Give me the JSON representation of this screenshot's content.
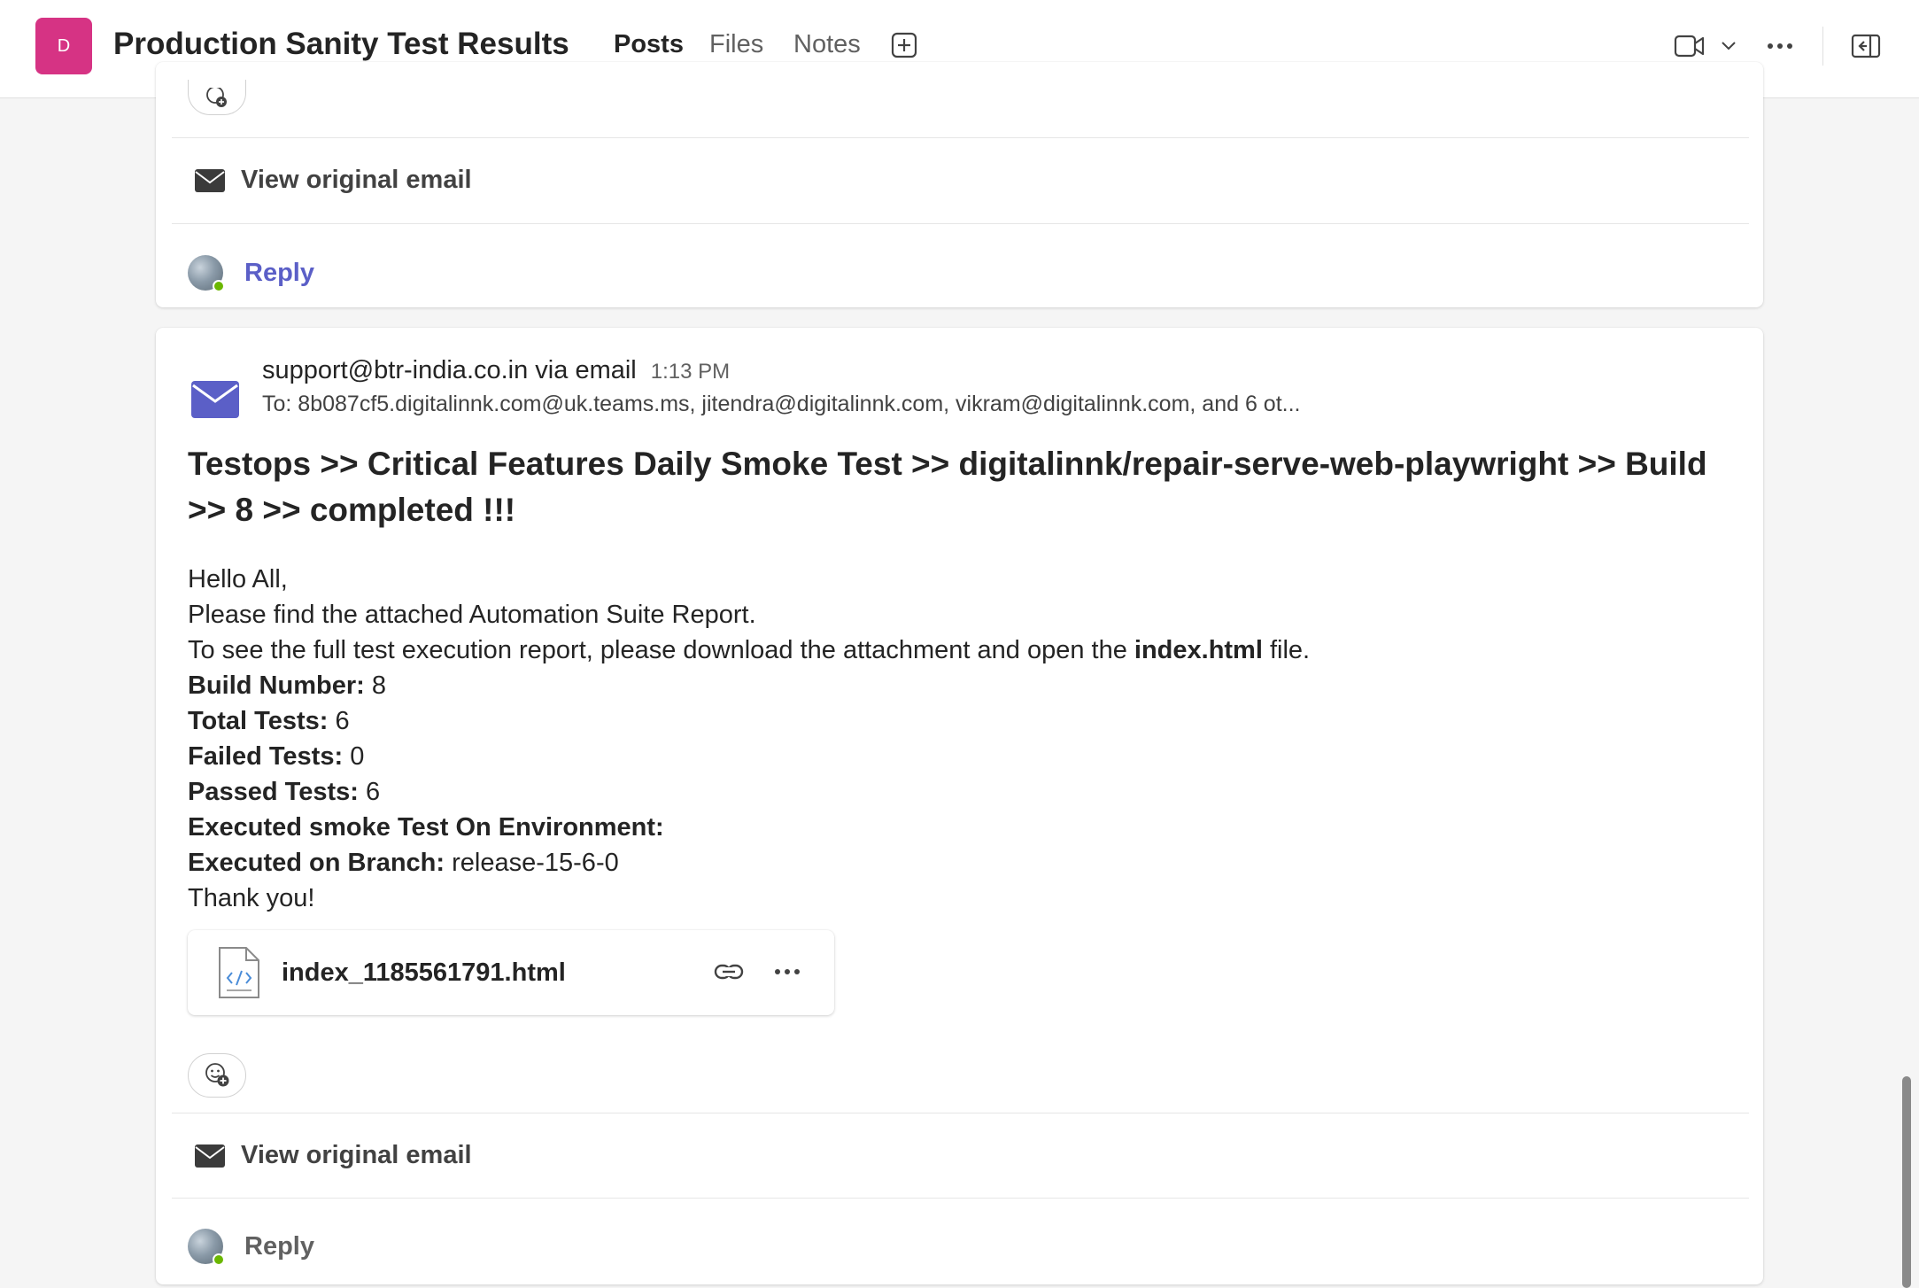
{
  "header": {
    "avatar_letter": "D",
    "avatar_color": "#d63384",
    "title": "Production Sanity Test Results",
    "tabs": [
      {
        "label": "Posts",
        "active": true
      },
      {
        "label": "Files",
        "active": false
      },
      {
        "label": "Notes",
        "active": false
      }
    ],
    "accent_color": "#5b5fc7"
  },
  "previous_post": {
    "view_original_label": "View original email",
    "reply_label": "Reply"
  },
  "post": {
    "sender": "support@btr-india.co.in via email",
    "time": "1:13 PM",
    "recipients": "To: 8b087cf5.digitalinnk.com@uk.teams.ms, jitendra@digitalinnk.com, vikram@digitalinnk.com, and 6 ot...",
    "subject": "Testops >> Critical Features Daily Smoke Test >> digitalinnk/repair-serve-web-playwright >> Build >> 8 >> completed !!!",
    "greeting": "Hello All,",
    "line1": "Please find the attached Automation Suite Report.",
    "line2_pre": "To see the full test execution report, please download the attachment and open the ",
    "line2_bold": "index.html",
    "line2_post": " file.",
    "build_number_label": "Build Number:",
    "build_number": "8",
    "total_tests_label": "Total Tests:",
    "total_tests": "6",
    "failed_tests_label": "Failed Tests:",
    "failed_tests": "0",
    "passed_tests_label": "Passed Tests:",
    "passed_tests": "6",
    "environment_label": "Executed smoke Test On Environment:",
    "branch_label": "Executed on Branch:",
    "branch": "release-15-6-0",
    "closing": "Thank you!",
    "attachment_name": "index_1185561791.html",
    "view_original_label": "View original email",
    "reply_label": "Reply"
  }
}
